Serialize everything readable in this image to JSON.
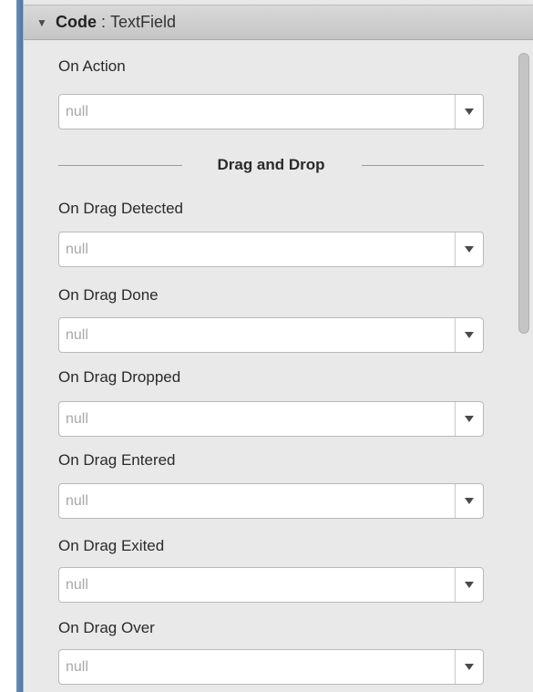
{
  "header": {
    "toggle_glyph": "▼",
    "title": "Code",
    "separator": ":",
    "subtitle": "TextField"
  },
  "on_action": {
    "label": "On Action",
    "value": "null"
  },
  "section": {
    "title": "Drag and Drop"
  },
  "fields": [
    {
      "label": "On Drag Detected",
      "value": "null"
    },
    {
      "label": "On Drag Done",
      "value": "null"
    },
    {
      "label": "On Drag Dropped",
      "value": "null"
    },
    {
      "label": "On Drag Entered",
      "value": "null"
    },
    {
      "label": "On Drag Exited",
      "value": "null"
    },
    {
      "label": "On Drag Over",
      "value": "null"
    }
  ],
  "icons": {
    "toggle": "triangle-down-icon",
    "dropdown": "chevron-down-icon"
  }
}
